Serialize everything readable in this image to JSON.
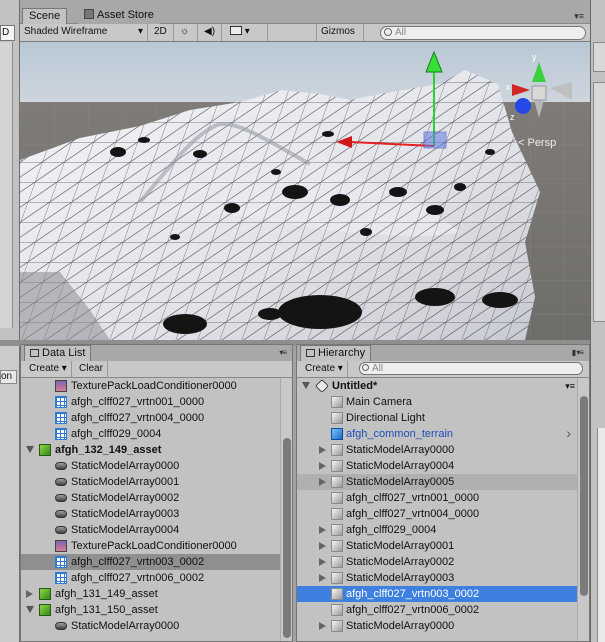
{
  "left_strip": {
    "field_text": "D",
    "bottom_label": "on"
  },
  "scene": {
    "tabs": [
      {
        "label": "Scene",
        "active": true
      },
      {
        "label": "Asset Store",
        "active": false
      }
    ],
    "toolbar": {
      "draw_mode": "Shaded Wireframe",
      "mode_2d": "2D",
      "gizmos": "Gizmos",
      "search_placeholder": "All"
    },
    "viewport": {
      "projection": "Persp",
      "axes": {
        "x": "x",
        "y": "y",
        "z": "z"
      }
    }
  },
  "data_list": {
    "title": "Data List",
    "create_label": "Create",
    "clear_label": "Clear",
    "rows": [
      {
        "indent": 1,
        "icon": "texture-pack-icon",
        "label": "TexturePackLoadConditioner0000",
        "arrow": ""
      },
      {
        "indent": 1,
        "icon": "grid-asset-icon",
        "label": "afgh_clff027_vrtn001_0000",
        "arrow": ""
      },
      {
        "indent": 1,
        "icon": "grid-asset-icon",
        "label": "afgh_clff027_vrtn004_0000",
        "arrow": ""
      },
      {
        "indent": 1,
        "icon": "grid-asset-icon",
        "label": "afgh_clff029_0004",
        "arrow": ""
      },
      {
        "indent": 0,
        "icon": "green-cube-icon",
        "label": "afgh_132_149_asset",
        "arrow": "down",
        "bold": true
      },
      {
        "indent": 1,
        "icon": "model-array-icon",
        "label": "StaticModelArray0000",
        "arrow": ""
      },
      {
        "indent": 1,
        "icon": "model-array-icon",
        "label": "StaticModelArray0001",
        "arrow": ""
      },
      {
        "indent": 1,
        "icon": "model-array-icon",
        "label": "StaticModelArray0002",
        "arrow": ""
      },
      {
        "indent": 1,
        "icon": "model-array-icon",
        "label": "StaticModelArray0003",
        "arrow": ""
      },
      {
        "indent": 1,
        "icon": "model-array-icon",
        "label": "StaticModelArray0004",
        "arrow": ""
      },
      {
        "indent": 1,
        "icon": "texture-pack-icon",
        "label": "TexturePackLoadConditioner0000",
        "arrow": ""
      },
      {
        "indent": 1,
        "icon": "grid-asset-icon",
        "label": "afgh_clff027_vrtn003_0002",
        "arrow": "",
        "selected": true
      },
      {
        "indent": 1,
        "icon": "grid-asset-icon",
        "label": "afgh_clff027_vrtn006_0002",
        "arrow": ""
      },
      {
        "indent": 0,
        "icon": "green-cube-icon",
        "label": "afgh_131_149_asset",
        "arrow": "right"
      },
      {
        "indent": 0,
        "icon": "green-cube-icon",
        "label": "afgh_131_150_asset",
        "arrow": "down"
      },
      {
        "indent": 1,
        "icon": "model-array-icon",
        "label": "StaticModelArray0000",
        "arrow": ""
      }
    ]
  },
  "hierarchy": {
    "title": "Hierarchy",
    "create_label": "Create",
    "search_placeholder": "All",
    "scene_name": "Untitled*",
    "rows": [
      {
        "icon": "gameobject-icon",
        "label": "Main Camera",
        "arrow": ""
      },
      {
        "icon": "gameobject-icon",
        "label": "Directional Light",
        "arrow": ""
      },
      {
        "icon": "terrain-cube-icon",
        "label": "afgh_common_terrain",
        "arrow": "",
        "prefab": true
      },
      {
        "icon": "gameobject-icon",
        "label": "StaticModelArray0000",
        "arrow": "right"
      },
      {
        "icon": "gameobject-icon",
        "label": "StaticModelArray0004",
        "arrow": "right"
      },
      {
        "icon": "gameobject-icon",
        "label": "StaticModelArray0005",
        "arrow": "right",
        "hover": true
      },
      {
        "icon": "gameobject-icon",
        "label": "afgh_clff027_vrtn001_0000",
        "arrow": ""
      },
      {
        "icon": "gameobject-icon",
        "label": "afgh_clff027_vrtn004_0000",
        "arrow": ""
      },
      {
        "icon": "gameobject-icon",
        "label": "afgh_clff029_0004",
        "arrow": "right"
      },
      {
        "icon": "gameobject-icon",
        "label": "StaticModelArray0001",
        "arrow": "right"
      },
      {
        "icon": "gameobject-icon",
        "label": "StaticModelArray0002",
        "arrow": "right"
      },
      {
        "icon": "gameobject-icon",
        "label": "StaticModelArray0003",
        "arrow": "right"
      },
      {
        "icon": "gameobject-icon",
        "label": "afgh_clff027_vrtn003_0002",
        "arrow": "",
        "selected": true
      },
      {
        "icon": "gameobject-icon",
        "label": "afgh_clff027_vrtn006_0002",
        "arrow": ""
      },
      {
        "icon": "gameobject-icon",
        "label": "StaticModelArray0000",
        "arrow": "right"
      }
    ]
  },
  "colors": {
    "selection_blue": "#3d80df",
    "prefab_blue": "#1f4fb8",
    "panel_gray": "#c2c2c2"
  }
}
